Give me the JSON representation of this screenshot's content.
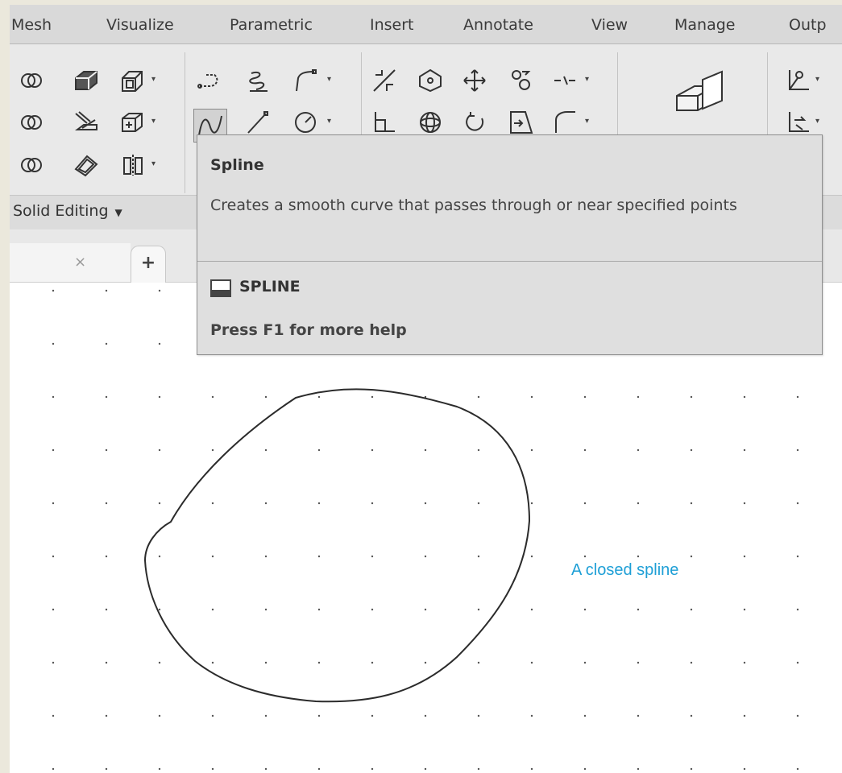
{
  "ribbon_tabs": [
    "Mesh",
    "Visualize",
    "Parametric",
    "Insert",
    "Annotate",
    "View",
    "Manage",
    "Outp"
  ],
  "panel_title": "Solid Editing",
  "tooltip": {
    "title": "Spline",
    "description": "Creates a smooth curve that passes through or near specified points",
    "command": "SPLINE",
    "help": "Press F1 for more help"
  },
  "annotation": {
    "text": "A closed spline",
    "color": "#1e9fd6"
  },
  "doc_tab": {
    "close_symbol": "×",
    "new_tab_symbol": "+"
  },
  "icons": [
    "intersect-icon",
    "extrude-faces-icon",
    "offset-faces-icon",
    "union-icon",
    "slice-icon",
    "imprint-icon",
    "subtract-icon",
    "shell-icon",
    "separate-icon",
    "polyline-icon",
    "helix-icon",
    "fit-spline-icon",
    "spline-icon",
    "line-icon",
    "circle-icon",
    "trim-icon",
    "3d-move-gizmo-icon",
    "move-icon",
    "copy-icon",
    "break-icon",
    "fillet-icon",
    "3d-rotate-gizmo-icon",
    "rotate-icon",
    "stretch-icon",
    "chamfer-icon",
    "section-plane-icon",
    "dimension-icon",
    "ucs-icon"
  ]
}
